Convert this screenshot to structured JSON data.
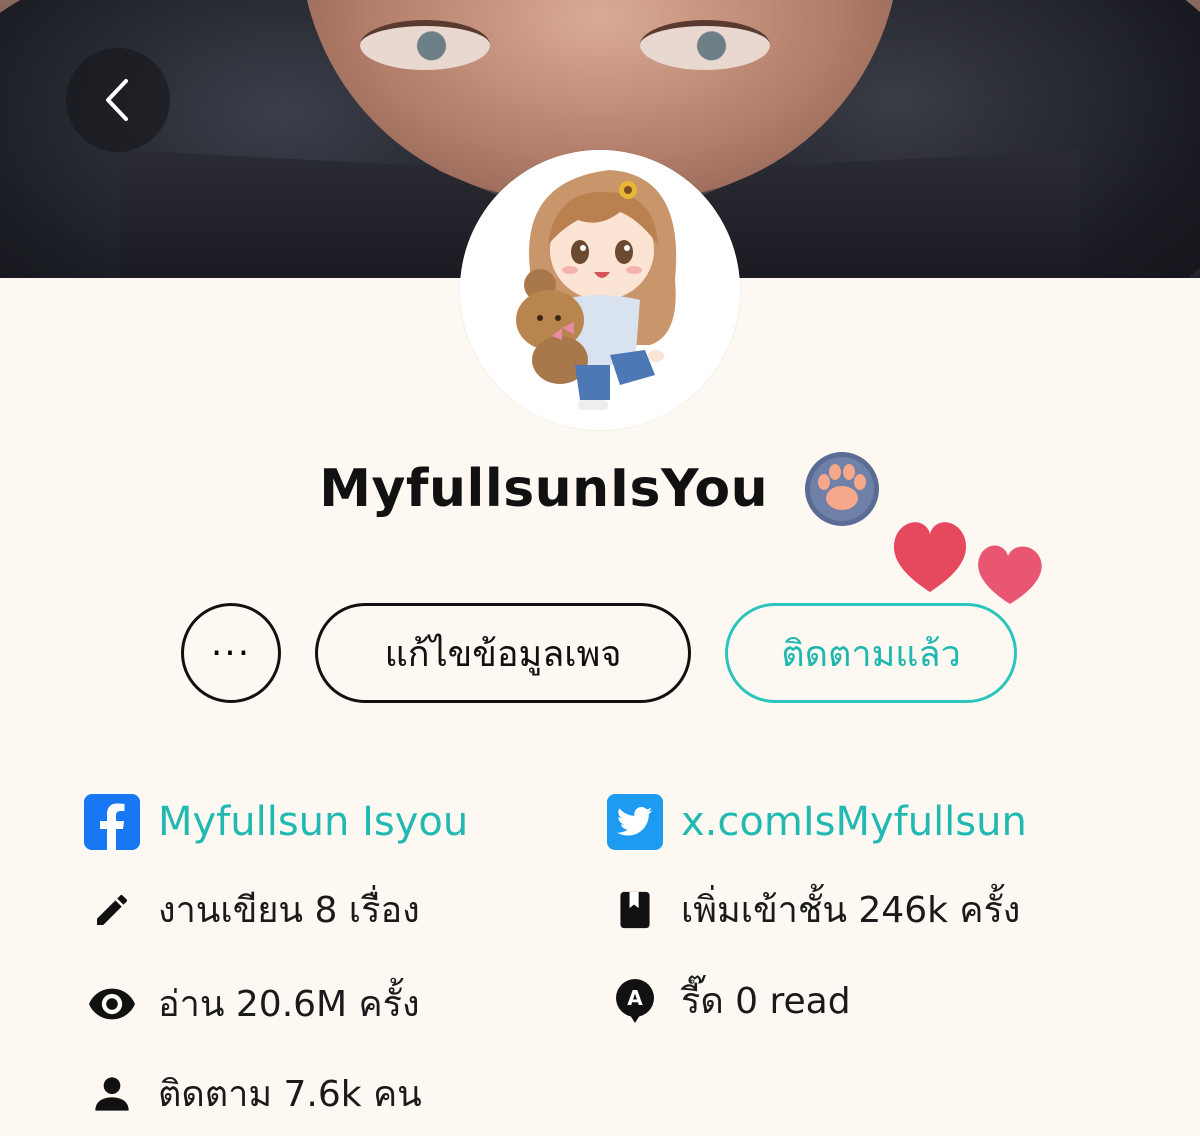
{
  "profile": {
    "username": "MyfullsunIsYou",
    "badge_icon": "paw-icon",
    "avatar_icon": "chibi-girl-with-teddy-bear-avatar"
  },
  "colors": {
    "accent": "#21b9b1",
    "background": "#fdf9f2",
    "facebook": "#1877f2",
    "twitter": "#1d9bf0",
    "heart": "#e6485e"
  },
  "actions": {
    "more_label": "···",
    "edit_label": "แก้ไขข้อมูลเพจ",
    "follow_label": "ติดตามแล้ว"
  },
  "socials": {
    "facebook": "Myfullsun Isyou",
    "twitter": "x.comIsMyfullsun"
  },
  "stats": {
    "works": "งานเขียน 8 เรื่อง",
    "library_adds": "เพิ่มเข้าชั้น 246k ครั้ง",
    "reads": "อ่าน 20.6M ครั้ง",
    "read_status": "รี๊ด 0 read",
    "followers": "ติดตาม 7.6k คน"
  }
}
